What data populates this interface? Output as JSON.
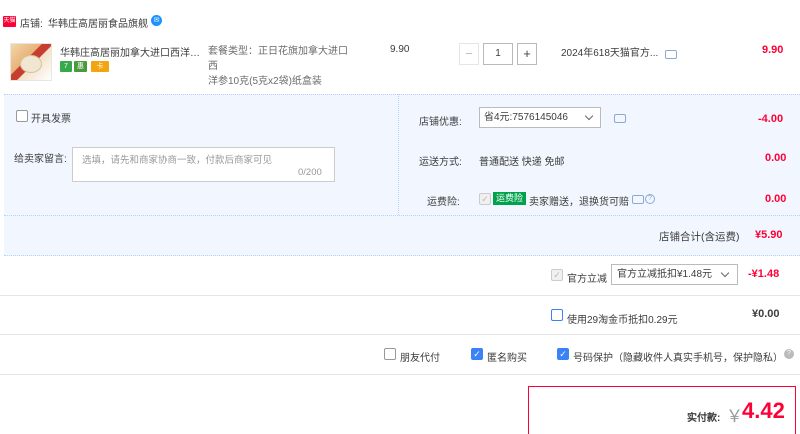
{
  "shop": {
    "tag": "天猫",
    "label": "店铺:",
    "name": "华韩庄高居丽食品旗舰",
    "chat_icon": "wangwang-icon"
  },
  "item": {
    "title": "华韩庄高居丽加拿大进口西洋参...",
    "badges": [
      "7",
      "惠",
      "卡"
    ],
    "sku_line1": "套餐类型：正日花旗加拿大进口西",
    "sku_line2": "洋参10克(5克x2袋)纸盒装",
    "unit_price": "9.90",
    "qty_minus": "−",
    "qty_value": "1",
    "qty_plus": "+",
    "delivery": "2024年618天猫官方...",
    "total": "9.90"
  },
  "options": {
    "invoice_label": "开具发票",
    "message_label": "给卖家留言:",
    "message_placeholder": "选填，请先和商家协商一致，付款后商家可见",
    "message_count": "0/200",
    "coupon_label": "店铺优惠:",
    "coupon_value": "省4元:7576145046",
    "coupon_amount": "-4.00",
    "shipping_label": "运送方式:",
    "shipping_value": "普通配送 快递 免邮",
    "shipping_amount": "0.00",
    "insurance_label": "运费险:",
    "insurance_tag": "运费险",
    "insurance_text": "卖家赠送，退换货可赔",
    "insurance_amount": "0.00"
  },
  "shop_total": {
    "label": "店铺合计(含运费)",
    "value": "¥5.90"
  },
  "discount": {
    "label": "官方立减",
    "select": "官方立减抵扣¥1.48元",
    "amount": "-¥1.48"
  },
  "coins": {
    "label": "使用29淘金币抵扣0.29元",
    "amount": "¥0.00"
  },
  "extras": {
    "friend_pay": "朋友代付",
    "anonymous": "匿名购买",
    "privacy": "号码保护（隐藏收件人真实手机号，保护隐私）"
  },
  "payment": {
    "label": "实付款:",
    "yen": "￥",
    "amount": "4.42"
  }
}
